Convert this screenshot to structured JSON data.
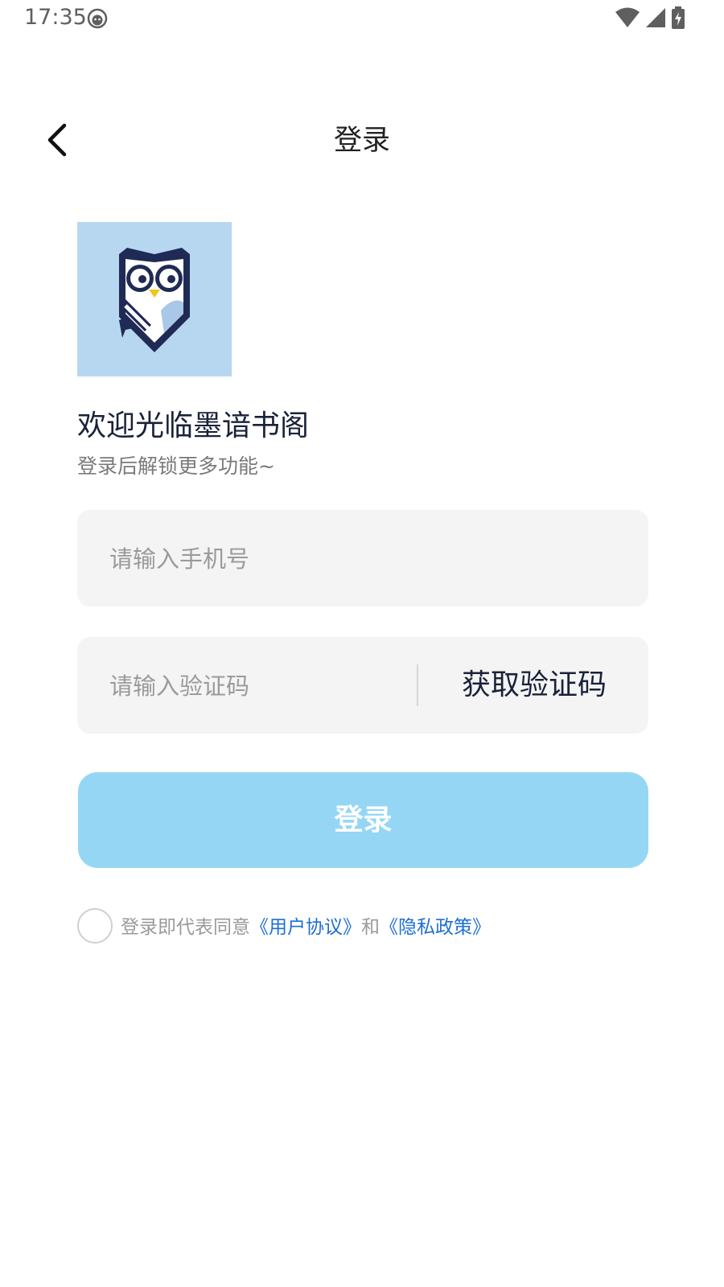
{
  "status_bar": {
    "time": "17:35",
    "icons": [
      "face-icon",
      "wifi-icon",
      "signal-icon",
      "battery-charging-icon"
    ]
  },
  "header": {
    "title": "登录",
    "back_icon": "chevron-left-icon"
  },
  "logo": {
    "icon": "owl-book-logo",
    "background_color": "#b7d7f0"
  },
  "welcome": {
    "title": "欢迎光临墨谙书阁",
    "subtitle": "登录后解锁更多功能~"
  },
  "form": {
    "phone_placeholder": "请输入手机号",
    "phone_value": "",
    "code_placeholder": "请输入验证码",
    "code_value": "",
    "get_code_label": "获取验证码",
    "login_label": "登录"
  },
  "agreement": {
    "checked": false,
    "prefix": "登录即代表同意",
    "user_agreement": "《用户协议》",
    "conjunction": "和",
    "privacy_policy": "《隐私政策》"
  },
  "colors": {
    "login_button": "#95d6f5",
    "link": "#1e6fd0",
    "field_background": "#f4f4f4"
  }
}
